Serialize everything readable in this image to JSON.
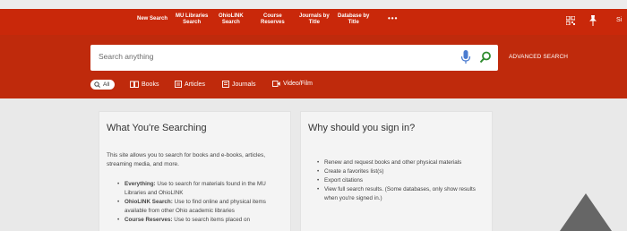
{
  "nav": {
    "items": [
      {
        "label": "New Search"
      },
      {
        "label": "MU Libraries\nSearch"
      },
      {
        "label": "OhioLINK\nSearch"
      },
      {
        "label": "Course\nReserves"
      },
      {
        "label": "Journals by\nTitle"
      },
      {
        "label": "Database by\nTitle"
      }
    ],
    "more": "•••",
    "signin_partial": "Si"
  },
  "search": {
    "placeholder": "Search anything",
    "advanced_label": "ADVANCED SEARCH"
  },
  "filters": [
    {
      "label": "All",
      "icon": "search-icon"
    },
    {
      "label": "Books",
      "icon": "book-icon"
    },
    {
      "label": "Articles",
      "icon": "article-icon"
    },
    {
      "label": "Journals",
      "icon": "journal-icon"
    },
    {
      "label": "Video/Film",
      "icon": "video-icon"
    }
  ],
  "left_card": {
    "title": "What You're Searching",
    "intro": "This site allows you to search for books and e-books, articles, streaming media, and more.",
    "items": [
      {
        "term": "Everything:",
        "text": " Use to search for materials found in the MU Libraries and OhioLINK"
      },
      {
        "term": "OhioLINK Search:",
        "text": " Use to find online and physical items available from other Ohio academic libraries"
      },
      {
        "term": "Course Reserves:",
        "text": " Use to search items placed on"
      }
    ]
  },
  "right_card": {
    "title": "Why should you sign in?",
    "items": [
      "Renew and request books and other physical materials",
      "Create a favorites list(s)",
      "Export citations",
      "View full search results. (Some databases, only show results when you're signed in.)"
    ]
  },
  "colors": {
    "nav_bg": "#c9280a",
    "hero_bg": "#bf2a0c",
    "search_icon_green": "#2e8b2e",
    "mic_blue": "#4a7bd0"
  }
}
